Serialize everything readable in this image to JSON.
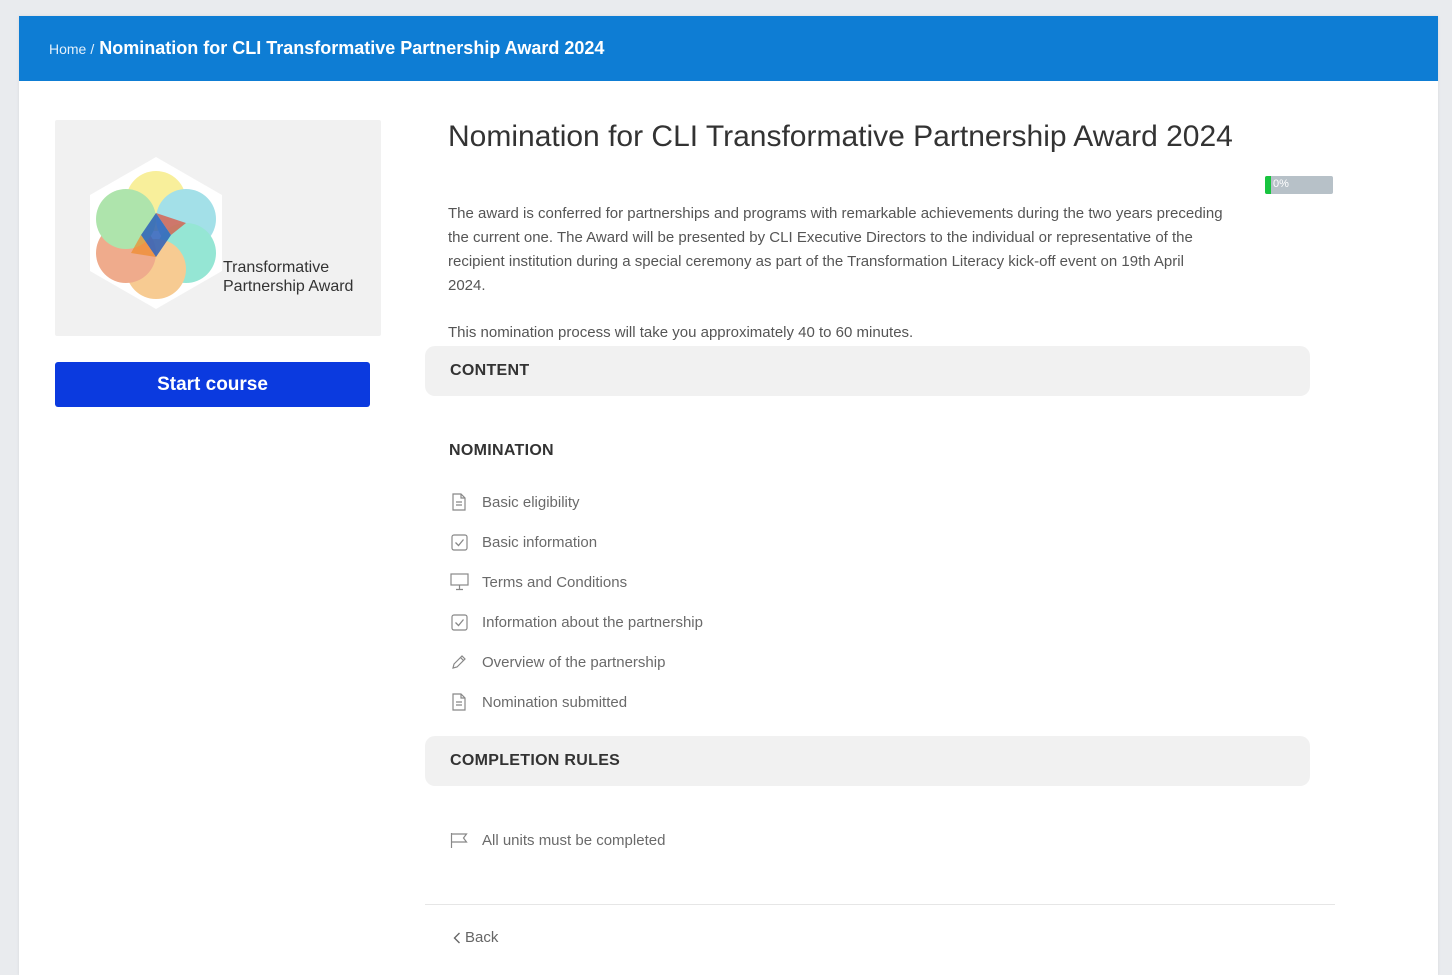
{
  "breadcrumb": {
    "home": "Home",
    "separator": "/",
    "current": "Nomination for CLI Transformative Partnership Award 2024"
  },
  "course": {
    "title": "Nomination for CLI Transformative Partnership Award 2024",
    "thumbnail_text_line1": "Transformative",
    "thumbnail_text_line2": "Partnership Award",
    "description": "The award is conferred for partnerships and programs with remarkable achievements during the two years preceding the current one. The Award will be presented by CLI Executive Directors to the individual or representative of the recipient institution during a special ceremony as part of the Transformation Literacy kick-off event on 19th April 2024.",
    "duration": "This nomination process will take you approximately 40 to 60 minutes.",
    "progress": {
      "value": 0,
      "label": "0%"
    },
    "start_label": "Start course"
  },
  "content": {
    "heading": "CONTENT",
    "unit_group": "NOMINATION",
    "units": [
      {
        "label": "Basic eligibility",
        "icon": "document-icon"
      },
      {
        "label": "Basic information",
        "icon": "checkbox-icon"
      },
      {
        "label": "Terms and Conditions",
        "icon": "monitor-icon"
      },
      {
        "label": "Information about the partnership",
        "icon": "checkbox-icon"
      },
      {
        "label": "Overview of the partnership",
        "icon": "pencil-icon"
      },
      {
        "label": "Nomination submitted",
        "icon": "document-icon"
      }
    ]
  },
  "completion": {
    "heading": "COMPLETION RULES",
    "rule": "All units must be completed",
    "rule_icon": "flag-icon"
  },
  "footer": {
    "back_label": "Back"
  },
  "colors": {
    "topbar": "#0e7dd4",
    "start_button": "#0b3adf",
    "progress_fill": "#18c43f"
  }
}
